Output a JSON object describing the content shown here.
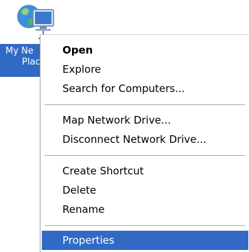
{
  "desktop_icon": {
    "label_line1": "My Ne",
    "label_line2": "Plac",
    "icon": "network-places-icon"
  },
  "context_menu": {
    "items": [
      {
        "label": "Open"
      },
      {
        "label": "Explore"
      },
      {
        "label": "Search for Computers..."
      },
      {
        "label": "Map Network Drive..."
      },
      {
        "label": "Disconnect Network Drive..."
      },
      {
        "label": "Create Shortcut"
      },
      {
        "label": "Delete"
      },
      {
        "label": "Rename"
      },
      {
        "label": "Properties"
      }
    ]
  },
  "colors": {
    "selection": "#316ac5",
    "separator": "#a8a8a8"
  }
}
